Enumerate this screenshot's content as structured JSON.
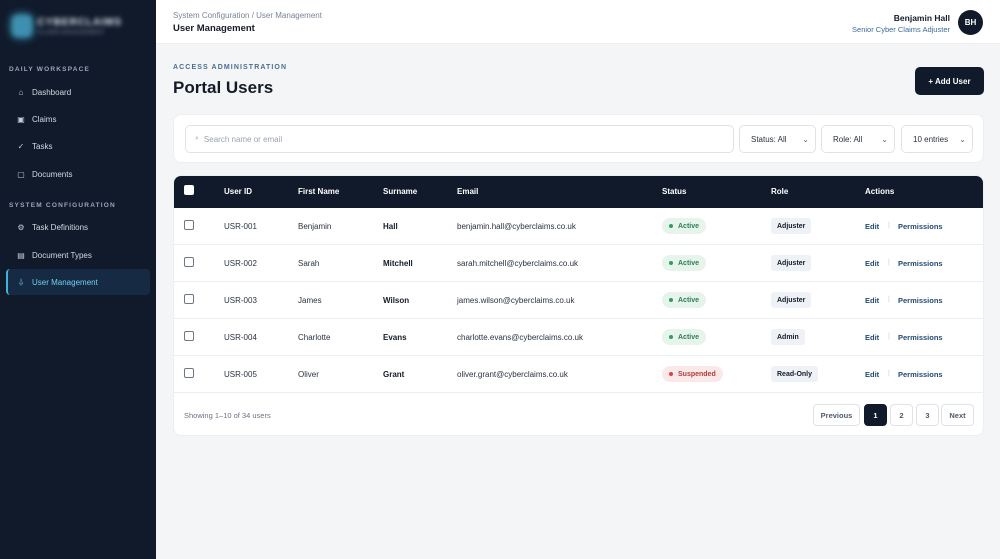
{
  "brand": {
    "name": "CYBERCLAIMS",
    "tagline": "CLAIMS MANAGEMENT"
  },
  "sidebar": {
    "sections": [
      {
        "title": "DAILY WORKSPACE",
        "items": [
          {
            "label": "Dashboard",
            "icon": "home-icon"
          },
          {
            "label": "Claims",
            "icon": "claims-icon"
          },
          {
            "label": "Tasks",
            "icon": "check-icon"
          },
          {
            "label": "Documents",
            "icon": "document-icon"
          }
        ]
      },
      {
        "title": "SYSTEM CONFIGURATION",
        "items": [
          {
            "label": "Task Definitions",
            "icon": "gear-icon"
          },
          {
            "label": "Document Types",
            "icon": "document-types-icon"
          },
          {
            "label": "User Management",
            "icon": "user-icon",
            "active": true
          }
        ]
      }
    ]
  },
  "header": {
    "breadcrumb": "System Configuration / User Management",
    "title": "User Management",
    "user": {
      "name": "Benjamin Hall",
      "role": "Senior Cyber Claims Adjuster",
      "initials": "BH"
    }
  },
  "page": {
    "kicker": "ACCESS ADMINISTRATION",
    "title": "Portal Users",
    "add_button": "+ Add User"
  },
  "filters": {
    "search_placeholder": "Search name or email",
    "status": "Status: All",
    "role": "Role: All",
    "entries": "10 entries"
  },
  "table": {
    "columns": [
      "User ID",
      "First Name",
      "Surname",
      "Email",
      "Status",
      "Role",
      "Actions"
    ],
    "rows": [
      {
        "id": "USR-001",
        "first": "Benjamin",
        "surname": "Hall",
        "email": "benjamin.hall@cyberclaims.co.uk",
        "status": "Active",
        "role": "Adjuster"
      },
      {
        "id": "USR-002",
        "first": "Sarah",
        "surname": "Mitchell",
        "email": "sarah.mitchell@cyberclaims.co.uk",
        "status": "Active",
        "role": "Adjuster"
      },
      {
        "id": "USR-003",
        "first": "James",
        "surname": "Wilson",
        "email": "james.wilson@cyberclaims.co.uk",
        "status": "Active",
        "role": "Adjuster"
      },
      {
        "id": "USR-004",
        "first": "Charlotte",
        "surname": "Evans",
        "email": "charlotte.evans@cyberclaims.co.uk",
        "status": "Active",
        "role": "Admin"
      },
      {
        "id": "USR-005",
        "first": "Oliver",
        "surname": "Grant",
        "email": "oliver.grant@cyberclaims.co.uk",
        "status": "Suspended",
        "role": "Read-Only"
      }
    ],
    "actions": {
      "edit": "Edit",
      "permissions": "Permissions",
      "separator": "|"
    }
  },
  "footer": {
    "showing": "Showing 1–10 of 34 users",
    "pagination": {
      "previous": "Previous",
      "pages": [
        "1",
        "2",
        "3"
      ],
      "current": "1",
      "next": "Next"
    }
  },
  "colors": {
    "sidebar": "#101a2b",
    "accent": "#40b4d8",
    "active_status": "#2f9e5f",
    "suspended_status": "#d14848"
  }
}
